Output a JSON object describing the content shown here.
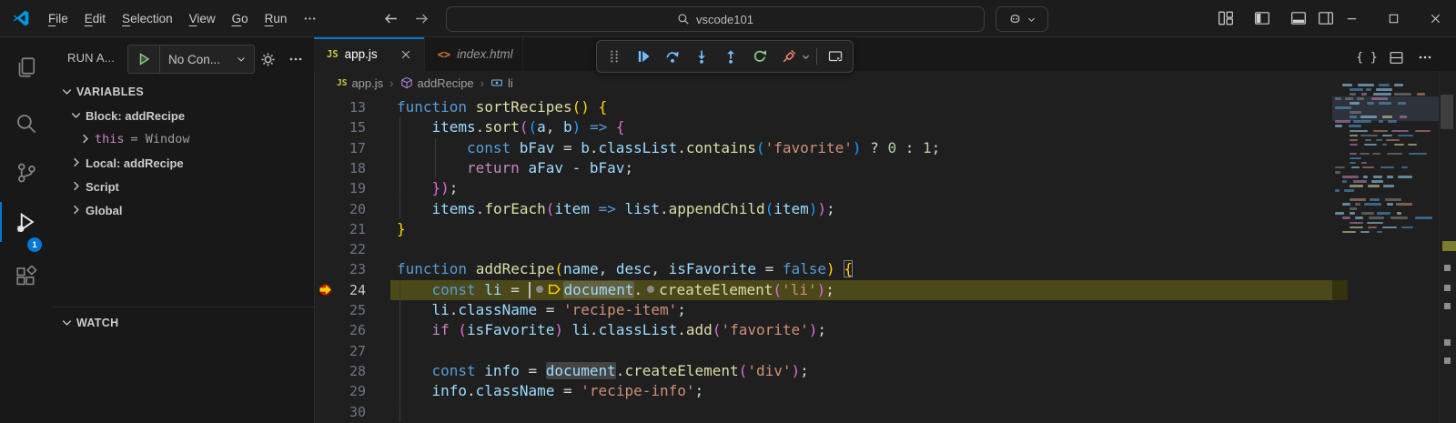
{
  "titlebar": {
    "menu": [
      "File",
      "Edit",
      "Selection",
      "View",
      "Go",
      "Run"
    ],
    "search_value": "vscode101"
  },
  "activity_bar": {
    "items": [
      {
        "id": "explorer",
        "active": false
      },
      {
        "id": "search",
        "active": false
      },
      {
        "id": "source-control",
        "active": false
      },
      {
        "id": "run-and-debug",
        "active": true,
        "badge": "1"
      },
      {
        "id": "extensions",
        "active": false
      }
    ]
  },
  "sidebar": {
    "title": "RUN A...",
    "config_value": "No Con...",
    "sections": [
      {
        "label": "VARIABLES",
        "expanded": true,
        "items": [
          {
            "label": "Block: addRecipe",
            "expanded": true,
            "level": 1
          },
          {
            "name": "this",
            "value": "= Window",
            "expanded": false,
            "level": 2
          },
          {
            "label": "Local: addRecipe",
            "expanded": false,
            "level": 1
          },
          {
            "label": "Script",
            "expanded": false,
            "level": 1
          },
          {
            "label": "Global",
            "expanded": false,
            "level": 1
          }
        ]
      },
      {
        "label": "WATCH",
        "expanded": true,
        "items": []
      }
    ]
  },
  "editor": {
    "tabs": [
      {
        "label": "app.js",
        "icon": "js",
        "active": true,
        "closable": true,
        "italic": false
      },
      {
        "label": "index.html",
        "icon": "html",
        "active": false,
        "closable": false,
        "italic": true
      }
    ],
    "breadcrumb": [
      {
        "label": "app.js",
        "icon": "js"
      },
      {
        "label": "addRecipe",
        "icon": "symbol-function"
      },
      {
        "label": "li",
        "icon": "symbol-variable"
      }
    ],
    "lines": [
      {
        "n": "13",
        "g": 0,
        "i": 0,
        "segs": [
          [
            "kw",
            "function "
          ],
          [
            "fn",
            "sortRecipes"
          ],
          [
            "b1",
            "()"
          ],
          [
            "p",
            " "
          ],
          [
            "b1",
            "{"
          ]
        ]
      },
      {
        "n": "15",
        "g": 1,
        "i": 1,
        "segs": [
          [
            "v",
            "items"
          ],
          [
            "p",
            "."
          ],
          [
            "fn",
            "sort"
          ],
          [
            "b2",
            "("
          ],
          [
            "b3",
            "("
          ],
          [
            "v",
            "a"
          ],
          [
            "p",
            ", "
          ],
          [
            "v",
            "b"
          ],
          [
            "b3",
            ")"
          ],
          [
            "kw",
            " => "
          ],
          [
            "b2",
            "{"
          ]
        ]
      },
      {
        "n": "17",
        "g": 2,
        "i": 2,
        "segs": [
          [
            "kw",
            "const "
          ],
          [
            "v",
            "bFav"
          ],
          [
            "p",
            " = "
          ],
          [
            "v",
            "b"
          ],
          [
            "p",
            "."
          ],
          [
            "v",
            "classList"
          ],
          [
            "p",
            "."
          ],
          [
            "fn",
            "contains"
          ],
          [
            "b3",
            "("
          ],
          [
            "s",
            "'favorite'"
          ],
          [
            "b3",
            ")"
          ],
          [
            "p",
            " ? "
          ],
          [
            "num",
            "0"
          ],
          [
            "p",
            " : "
          ],
          [
            "num",
            "1"
          ],
          [
            "p",
            ";"
          ]
        ]
      },
      {
        "n": "18",
        "g": 2,
        "i": 2,
        "segs": [
          [
            "ctl",
            "return "
          ],
          [
            "v",
            "aFav"
          ],
          [
            "p",
            " - "
          ],
          [
            "v",
            "bFav"
          ],
          [
            "p",
            ";"
          ]
        ]
      },
      {
        "n": "19",
        "g": 1,
        "i": 1,
        "segs": [
          [
            "b2",
            "})"
          ],
          [
            "p",
            ";"
          ]
        ]
      },
      {
        "n": "20",
        "g": 1,
        "i": 1,
        "segs": [
          [
            "v",
            "items"
          ],
          [
            "p",
            "."
          ],
          [
            "fn",
            "forEach"
          ],
          [
            "b2",
            "("
          ],
          [
            "v",
            "item"
          ],
          [
            "kw",
            " => "
          ],
          [
            "v",
            "list"
          ],
          [
            "p",
            "."
          ],
          [
            "fn",
            "appendChild"
          ],
          [
            "b3",
            "("
          ],
          [
            "v",
            "item"
          ],
          [
            "b3",
            ")"
          ],
          [
            "b2",
            ")"
          ],
          [
            "p",
            ";"
          ]
        ]
      },
      {
        "n": "21",
        "g": 0,
        "i": 0,
        "segs": [
          [
            "b1",
            "}"
          ]
        ]
      },
      {
        "n": "22",
        "g": 0,
        "i": 0,
        "segs": []
      },
      {
        "n": "23",
        "g": 0,
        "i": 0,
        "segs": [
          [
            "kw",
            "function "
          ],
          [
            "fn",
            "addRecipe"
          ],
          [
            "b1",
            "("
          ],
          [
            "v",
            "name"
          ],
          [
            "p",
            ", "
          ],
          [
            "v",
            "desc"
          ],
          [
            "p",
            ", "
          ],
          [
            "v",
            "isFavorite"
          ],
          [
            "p",
            " = "
          ],
          [
            "kw",
            "false"
          ],
          [
            "b1",
            ")"
          ],
          [
            "p",
            " "
          ],
          [
            "b1 bm",
            "{"
          ]
        ]
      },
      {
        "n": "24",
        "g": 1,
        "i": 1,
        "hl": true,
        "bp": true,
        "segs": [
          [
            "kw",
            "const "
          ],
          [
            "v",
            "li"
          ],
          [
            "p",
            " = "
          ],
          [
            "ic",
            "cursor"
          ],
          [
            "ic",
            "dot"
          ],
          [
            "ic",
            "frame"
          ],
          [
            "v wb",
            "document"
          ],
          [
            "p",
            "."
          ],
          [
            "ic",
            "dot"
          ],
          [
            "fn",
            "createElement"
          ],
          [
            "b2",
            "("
          ],
          [
            "s",
            "'li'"
          ],
          [
            "b2",
            ")"
          ],
          [
            "p",
            ";"
          ]
        ]
      },
      {
        "n": "25",
        "g": 1,
        "i": 1,
        "segs": [
          [
            "v",
            "li"
          ],
          [
            "p",
            "."
          ],
          [
            "v",
            "className"
          ],
          [
            "p",
            " = "
          ],
          [
            "s",
            "'recipe-item'"
          ],
          [
            "p",
            ";"
          ]
        ]
      },
      {
        "n": "26",
        "g": 1,
        "i": 1,
        "segs": [
          [
            "ctl",
            "if "
          ],
          [
            "b2",
            "("
          ],
          [
            "v",
            "isFavorite"
          ],
          [
            "b2",
            ")"
          ],
          [
            "p",
            " "
          ],
          [
            "v",
            "li"
          ],
          [
            "p",
            "."
          ],
          [
            "v",
            "classList"
          ],
          [
            "p",
            "."
          ],
          [
            "fn",
            "add"
          ],
          [
            "b2",
            "("
          ],
          [
            "s",
            "'favorite'"
          ],
          [
            "b2",
            ")"
          ],
          [
            "p",
            ";"
          ]
        ]
      },
      {
        "n": "27",
        "g": 1,
        "i": 0,
        "segs": []
      },
      {
        "n": "28",
        "g": 1,
        "i": 1,
        "segs": [
          [
            "kw",
            "const "
          ],
          [
            "v",
            "info"
          ],
          [
            "p",
            " = "
          ],
          [
            "v wb",
            "document"
          ],
          [
            "p",
            "."
          ],
          [
            "fn",
            "createElement"
          ],
          [
            "b2",
            "("
          ],
          [
            "s",
            "'div'"
          ],
          [
            "b2",
            ")"
          ],
          [
            "p",
            ";"
          ]
        ]
      },
      {
        "n": "29",
        "g": 1,
        "i": 1,
        "segs": [
          [
            "v",
            "info"
          ],
          [
            "p",
            "."
          ],
          [
            "v",
            "className"
          ],
          [
            "p",
            " = "
          ],
          [
            "s",
            "'recipe-info'"
          ],
          [
            "p",
            ";"
          ]
        ]
      },
      {
        "n": "30",
        "g": 1,
        "i": 0,
        "segs": []
      }
    ]
  },
  "debug_toolbar": {
    "buttons": [
      "grip",
      "continue",
      "step-over",
      "step-into",
      "step-out",
      "restart",
      "disconnect",
      "open-window"
    ]
  },
  "colors": {
    "accent": "#0078d4",
    "bg-dark": "#181818",
    "bg-editor": "#1f1f1f",
    "border": "#2b2b2b",
    "fg": "#cccccc",
    "fg-dim": "#9d9d9d",
    "fg-faint": "#6e7681",
    "hl-line": "#4b4919",
    "hl-line-minimap": "#34320f",
    "ruler-olive": "#7d7b2c",
    "bp-red": "#e51400",
    "frame-yellow": "#ffcc00",
    "c-kw": "#569cd6",
    "c-ctl": "#c586c0",
    "c-fn": "#dcdcaa",
    "c-v": "#9cdcfe",
    "c-s": "#ce9178",
    "c-num": "#b5cea8",
    "c-p": "#d4d4d4",
    "c-b1": "#ffd700",
    "c-b2": "#da70d6",
    "c-b3": "#179fff",
    "blue-icon": "#75beff",
    "green-icon": "#89d185",
    "red-icon": "#f48771",
    "js-yellow": "#cbcb41",
    "html-orange": "#e37933",
    "bc-func": "#b180d7"
  }
}
